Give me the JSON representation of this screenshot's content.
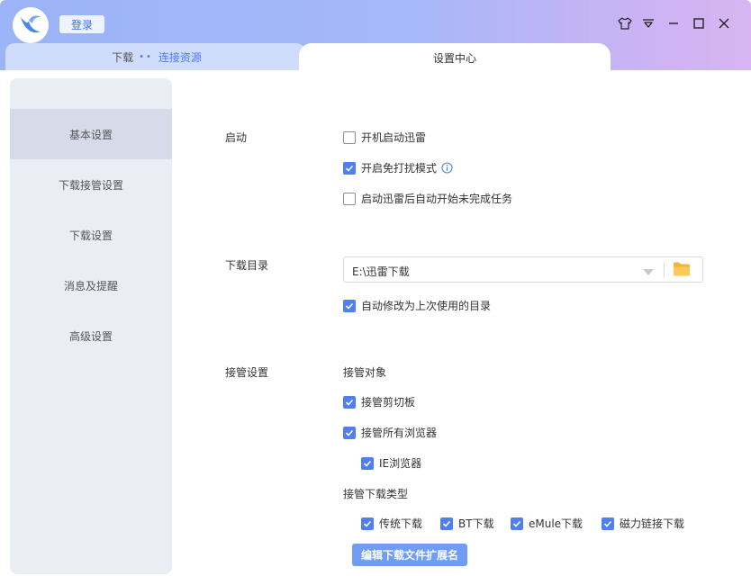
{
  "header": {
    "login_label": "登录"
  },
  "tabs": {
    "download_label": "下载",
    "download_link": "连接资源",
    "settings_label": "设置中心"
  },
  "sidebar": {
    "items": [
      {
        "label": "基本设置"
      },
      {
        "label": "下载接管设置"
      },
      {
        "label": "下载设置"
      },
      {
        "label": "消息及提醒"
      },
      {
        "label": "高级设置"
      }
    ]
  },
  "startup": {
    "section_label": "启动",
    "options": [
      {
        "label": "开机启动迅雷",
        "checked": false
      },
      {
        "label": "开启免打扰模式",
        "checked": true
      },
      {
        "label": "启动迅雷后自动开始未完成任务",
        "checked": false
      }
    ]
  },
  "download_dir": {
    "section_label": "下载目录",
    "path": "E:\\迅雷下载",
    "auto_change_label": "自动修改为上次使用的目录",
    "auto_change_checked": true
  },
  "takeover": {
    "section_label": "接管设置",
    "target_label": "接管对象",
    "clipboard_label": "接管剪切板",
    "all_browsers_label": "接管所有浏览器",
    "ie_label": "IE浏览器",
    "types_label": "接管下载类型",
    "types": [
      {
        "label": "传统下载",
        "checked": true
      },
      {
        "label": "BT下载",
        "checked": true
      },
      {
        "label": "eMule下载",
        "checked": true
      },
      {
        "label": "磁力链接下载",
        "checked": true
      }
    ],
    "edit_ext_label": "编辑下载文件扩展名"
  },
  "colors": {
    "accent": "#4f7ff0",
    "button": "#6f9cf5"
  }
}
